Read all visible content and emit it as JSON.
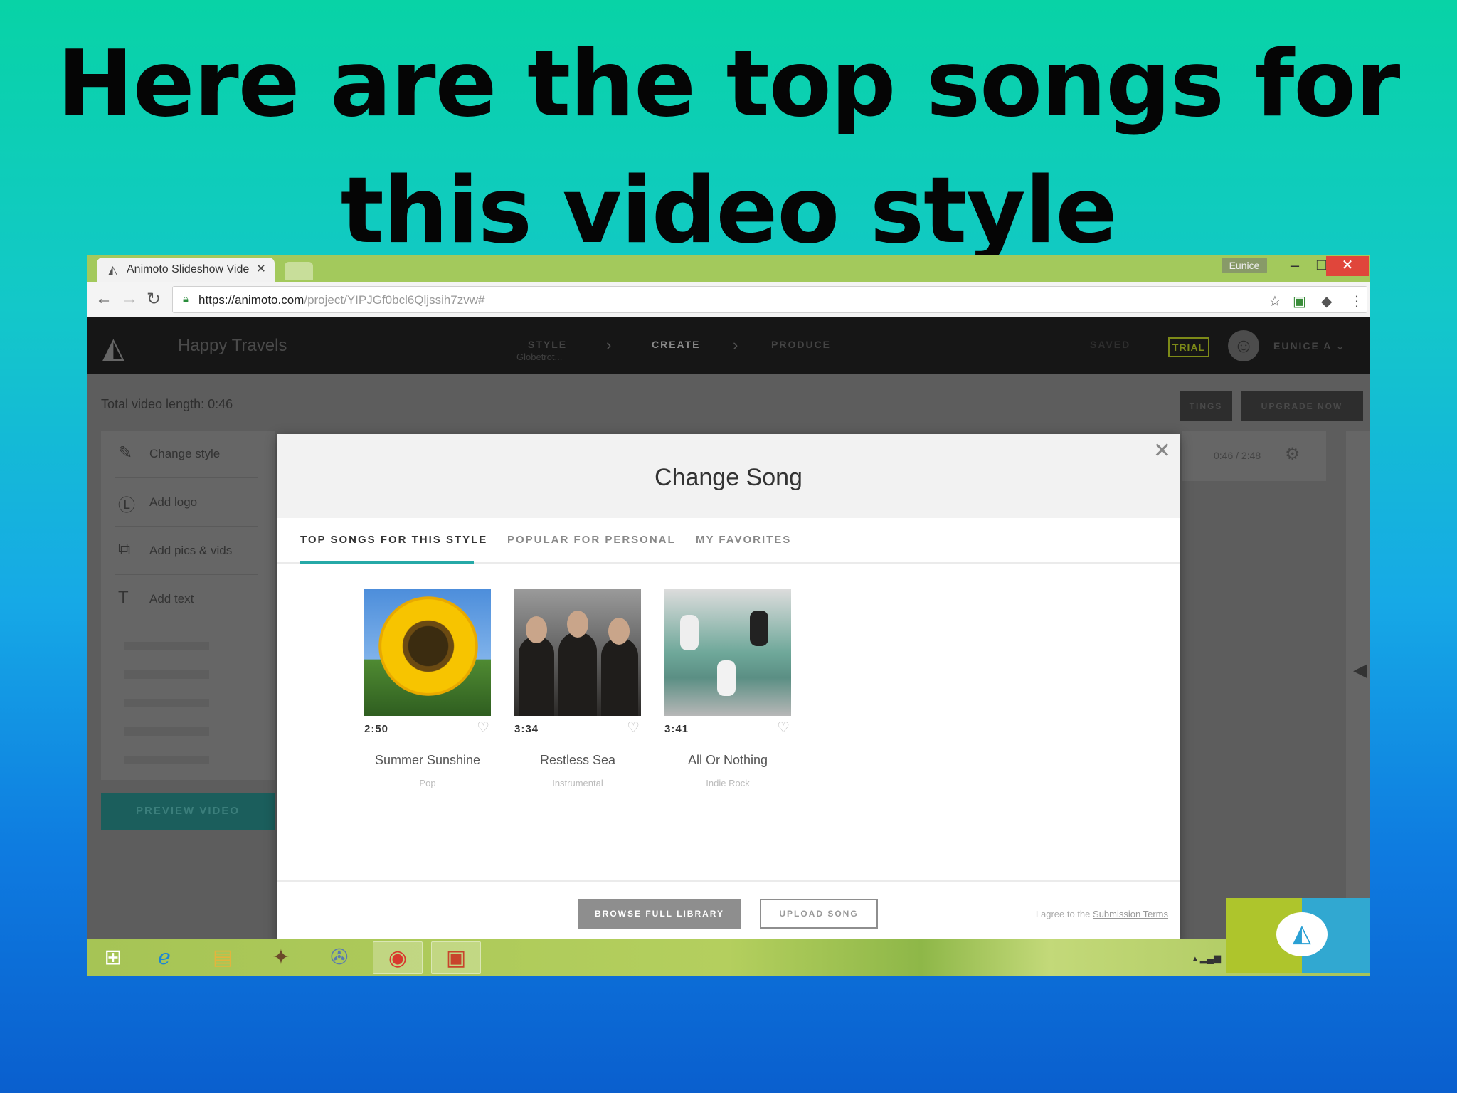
{
  "slide": {
    "title_line1": "Here are the top songs for",
    "title_line2": "this video style"
  },
  "browser": {
    "tab_title": "Animoto Slideshow Vide",
    "profile_name": "Eunice",
    "url_host": "https://animoto.com",
    "url_path": "/project/YIPJGf0bcl6Qljssih7zvw#"
  },
  "app": {
    "project_name": "Happy Travels",
    "steps": [
      {
        "label": "STYLE",
        "sub": "Globetrot..."
      },
      {
        "label": "CREATE"
      },
      {
        "label": "PRODUCE"
      }
    ],
    "saved_label": "SAVED",
    "trial_badge": "TRIAL",
    "user_menu": "EUNICE A",
    "video_length": "Total video length: 0:46",
    "sidebar_items": [
      "Change style",
      "Add logo",
      "Add pics & vids",
      "Add text"
    ],
    "preview_button": "PREVIEW VIDEO",
    "settings_button": "TINGS",
    "upgrade_button": "UPGRADE NOW",
    "timer": "0:46 / 2:48"
  },
  "modal": {
    "title": "Change Song",
    "tabs": [
      "TOP SONGS FOR THIS STYLE",
      "POPULAR FOR PERSONAL",
      "MY FAVORITES"
    ],
    "songs": [
      {
        "duration": "2:50",
        "title": "Summer Sunshine",
        "genre": "Pop"
      },
      {
        "duration": "3:34",
        "title": "Restless Sea",
        "genre": "Instrumental"
      },
      {
        "duration": "3:41",
        "title": "All Or Nothing",
        "genre": "Indie Rock"
      }
    ],
    "browse_button": "BROWSE FULL LIBRARY",
    "upload_button": "UPLOAD SONG",
    "terms_prefix": "I agree to the",
    "terms_link": "Submission Terms"
  },
  "colors": {
    "accent_teal": "#26a9a7",
    "close_red": "#e0463b",
    "taskbar_green": "#a6c455"
  }
}
